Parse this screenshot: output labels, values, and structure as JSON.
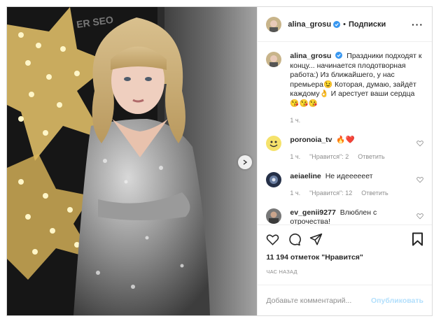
{
  "post": {
    "author": "alina_grosu",
    "follow_label": "Подписки",
    "dot": "•",
    "more_icon": "more-horizontal-icon",
    "photo_sign_text": "ER SEO"
  },
  "caption": {
    "username": "alina_grosu",
    "text": "Праздники подходят к концу... начинается плодотворная работа:) Из ближайшего, у нас премьера😉 Которая, думаю, зайдёт каждому👌 И арестует ваши сердца😘😘😘",
    "time": "1 ч."
  },
  "comments": [
    {
      "username": "poronoia_tv",
      "text": "🔥❤️",
      "time": "1 ч.",
      "likes": "\"Нравится\": 2",
      "reply": "Ответить"
    },
    {
      "username": "aeiaeline",
      "text": "Не идеееееет",
      "time": "1 ч.",
      "likes": "\"Нравится\": 12",
      "reply": "Ответить"
    },
    {
      "username": "ev_genii9277",
      "text": "Влюблен с отрочества!",
      "time": "",
      "likes": "",
      "reply": ""
    }
  ],
  "actions": {
    "likes_text": "11 194 отметок \"Нравится\"",
    "time_ago": "час назад"
  },
  "add_comment": {
    "placeholder": "Добавьте комментарий...",
    "publish_label": "Опубликовать"
  },
  "colors": {
    "accent_disabled": "#b2dffc",
    "muted": "#8e8e8e",
    "verified": "#3897f0",
    "heart": "#ed4956"
  }
}
